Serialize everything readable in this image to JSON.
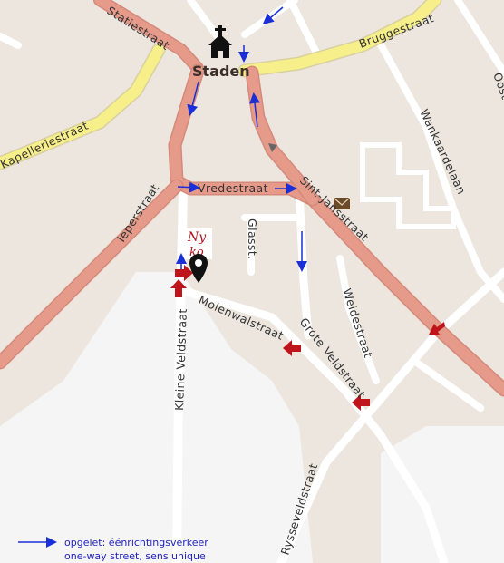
{
  "map": {
    "town": "Staden",
    "streets": {
      "statiestraat": "Statiestraat",
      "bruggestraat": "Bruggestraat",
      "kapelleriestraat": "Kapelleriestraat",
      "ieperstraat": "Ieperstraat",
      "vredestraat": "Vredestraat",
      "sintjansstraat": "Sint-Jansstraat",
      "wankaardelaan": "Wankaardelaan",
      "glasst": "Glasst.",
      "weidestraat": "Weidestraat",
      "molenwalstraat": "Molenwalstraat",
      "groteveldstraat": "Grote Veldstraat",
      "kleineveldstraat": "Kleine Veldstraat",
      "rysseveldstraat": "Rysseveldstraat",
      "oost": "Oost"
    },
    "logo": {
      "line1": "Ny",
      "line2": "ko"
    },
    "colors": {
      "background": "#ece6df",
      "primary_road": "#e59a8a",
      "secondary_road": "#f7ef8a",
      "minor_road": "#ffffff",
      "oneway_arrow": "#1a2fd6",
      "route_arrow": "#c0141c",
      "marker": "#111111"
    },
    "icons": [
      "church-icon",
      "mail-icon",
      "location-pin-icon",
      "oneway-arrow-icon",
      "route-arrow-icon"
    ]
  },
  "legend": {
    "line_nl": "opgelet: éénrichtingsverkeer",
    "line_en_fr": "one-way street, sens unique"
  }
}
